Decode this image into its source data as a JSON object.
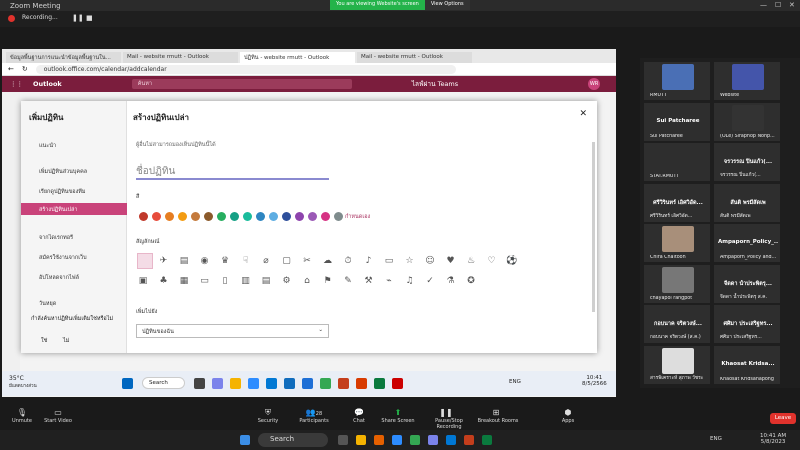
{
  "zoom": {
    "window_title": "Zoom Meeting",
    "share_notice": "You are viewing Website's screen",
    "view_options": "View Options",
    "recording": "Recording...",
    "controls": [
      "Unmute",
      "Start Video",
      "Security",
      "Participants",
      "Chat",
      "Share Screen",
      "Pause/Stop Recording",
      "Breakout Rooms",
      "Apps"
    ],
    "participants_count": "28",
    "leave": "Leave"
  },
  "browser": {
    "tabs": [
      "ข้อมูลพื้นฐานการแนะนำข้อมูลพื้นฐานใน...",
      "Mail - website rmutt - Outlook",
      "ปฏิทิน - website rmutt - Outlook",
      "Mail - website rmutt - Outlook"
    ],
    "url": "outlook.office.com/calendar/addcalendar"
  },
  "outlook": {
    "brand": "Outlook",
    "search_placeholder": "ค้นหา",
    "teams_label": "ไลฟ์ผ่าน Teams",
    "avatar": "WR"
  },
  "modal": {
    "sidebar_title": "เพิ่มปฏิทิน",
    "sidebar_items": [
      "แนะนำ",
      "เพิ่มปฏิทินส่วนบุคคล",
      "เรียกดูปฏิทินของทีม",
      "สร้างปฏิทินเปล่า",
      "จากไดเรกทอรี",
      "สมัครใช้งานจากเว็บ",
      "อัปโหลดจากไฟล์"
    ],
    "footer_label": "วันหยุด",
    "footer_question": "กำลังค้นหาปฏิทินเพิ่มเติมใช่หรือไม่",
    "yes": "ใช่",
    "no": "ไม่",
    "title": "สร้างปฏิทินเปล่า",
    "hint": "ผู้อื่นไม่สามารถมองเห็นปฏิทินนี้ได้",
    "name_placeholder": "ชื่อปฏิทิน",
    "color_label": "สี",
    "colors": [
      "#c0392b",
      "#e74c3c",
      "#e67e22",
      "#f39c12",
      "#c47a3c",
      "#8b5a2b",
      "#27ae60",
      "#16a085",
      "#1abc9c",
      "#2e86c1",
      "#5dade2",
      "#2e4f9b",
      "#8e44ad",
      "#9b59b6",
      "#d63384",
      "#7f8c8d"
    ],
    "custom_label": "กำหนดเอง",
    "symbol_label": "สัญลักษณ์",
    "add_to_label": "เพิ่มไปยัง",
    "add_to_value": "ปฏิทินของฉัน"
  },
  "taskbar_inner": {
    "weather_temp": "35°C",
    "weather_desc": "มีแดดบางส่วน",
    "search": "Search",
    "lang": "ENG",
    "time": "10:41",
    "date": "8/5/2566"
  },
  "gallery": [
    {
      "name": "RMUTT",
      "big": ""
    },
    {
      "name": "Website",
      "big": ""
    },
    {
      "name": "Sui Patcharee",
      "big": "Sui Patcharee"
    },
    {
      "name": "(OLe) Siraphop Nonp...",
      "big": ""
    },
    {
      "name": "STAT.RMUTT",
      "big": ""
    },
    {
      "name": "จรวรรณ ปิ่นแก้ว(...",
      "big": "จรวรรณ ปิ่นแก้ว(..."
    },
    {
      "name": "ศรีวิรินทร์ เอิศวิอัด...",
      "big": "ศรีวิรินทร์ เอิศวิอัด..."
    },
    {
      "name": "สันติ พรมีสัดเพ",
      "big": "สันติ พรมีสัดเพ"
    },
    {
      "name": "Chira Chaitoon",
      "big": ""
    },
    {
      "name": "Ampaporn_Policy and...",
      "big": "Ampaporn_Policy_..."
    },
    {
      "name": "chayapol rangpot",
      "big": ""
    },
    {
      "name": "จีดดา น้ำประพิตรุ ส.ค.",
      "big": "จีดดา น้ำประพิตรุ..."
    },
    {
      "name": "กอบนาค จริตวงษ์ (ส.ค.)",
      "big": "กอบนาค จริตวงษ์..."
    },
    {
      "name": "ศศิมา ประเสริฐทร...",
      "big": "ศศิมา ประเสริฐทร..."
    },
    {
      "name": "สารพิเคราะห์ สุภาพ วัชระ",
      "big": ""
    },
    {
      "name": "Khaosat Kridsanapong",
      "big": "Khaosat Kridsa..."
    }
  ],
  "win_taskbar": {
    "search": "Search",
    "lang": "ENG",
    "time": "10:41 AM",
    "date": "5/8/2023"
  }
}
